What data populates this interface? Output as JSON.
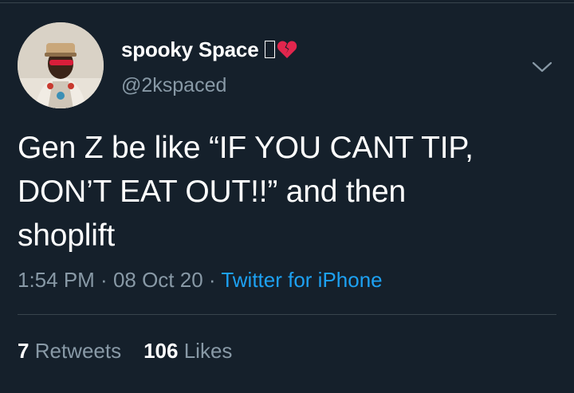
{
  "user": {
    "display_name": "spooky Space",
    "handle": "@2kspaced",
    "emoji_icons": [
      "missing-glyph-icon",
      "broken-heart-icon"
    ]
  },
  "tweet": {
    "text": "Gen Z be like “IF YOU CANT TIP,\nDON’T EAT OUT!!” and then\nshoplift"
  },
  "meta": {
    "time": "1:54 PM",
    "sep1": " · ",
    "date": "08 Oct 20",
    "sep2": " · ",
    "source": "Twitter for iPhone"
  },
  "stats": {
    "retweets_count": "7",
    "retweets_label": "Retweets",
    "likes_count": "106",
    "likes_label": "Likes"
  },
  "colors": {
    "background": "#15202b",
    "secondary_text": "#8899a6",
    "link": "#1da1f2",
    "broken_heart": "#e2264d"
  }
}
